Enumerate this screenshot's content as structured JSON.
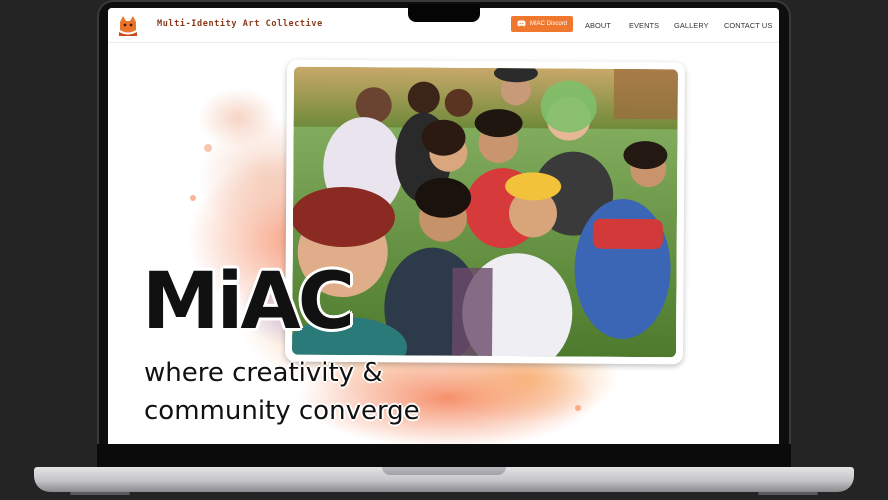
{
  "nav": {
    "brand": "Multi-Identity Art Collective",
    "discord_label": "MIAC Discord",
    "links": [
      "ABOUT",
      "EVENTS",
      "GALLERY",
      "CONTACT US"
    ]
  },
  "hero": {
    "title": "MiAC",
    "tagline_line1": "where creativity &",
    "tagline_line2": "community converge"
  },
  "colors": {
    "accent": "#f0782e",
    "brand_text": "#8a3a1a"
  },
  "icons": [
    "miac-logo-icon",
    "discord-icon"
  ]
}
